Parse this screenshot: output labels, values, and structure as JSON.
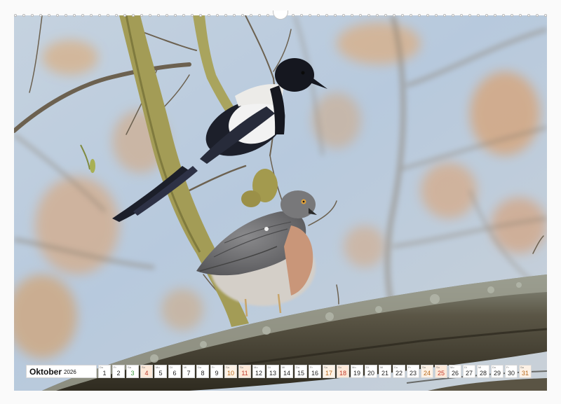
{
  "calendar": {
    "month": "Oktober",
    "year": "2026",
    "days": [
      {
        "num": "1",
        "wd": "Do",
        "type": "weekday"
      },
      {
        "num": "2",
        "wd": "Fr",
        "type": "weekday"
      },
      {
        "num": "3",
        "wd": "Sa",
        "type": "holiday"
      },
      {
        "num": "4",
        "wd": "So",
        "type": "sun"
      },
      {
        "num": "5",
        "wd": "Mo",
        "type": "weekday"
      },
      {
        "num": "6",
        "wd": "Di",
        "type": "weekday"
      },
      {
        "num": "7",
        "wd": "Mi",
        "type": "weekday"
      },
      {
        "num": "8",
        "wd": "Do",
        "type": "weekday"
      },
      {
        "num": "9",
        "wd": "Fr",
        "type": "weekday"
      },
      {
        "num": "10",
        "wd": "Sa",
        "type": "sat"
      },
      {
        "num": "11",
        "wd": "So",
        "type": "sun"
      },
      {
        "num": "12",
        "wd": "Mo",
        "type": "weekday"
      },
      {
        "num": "13",
        "wd": "Di",
        "type": "weekday"
      },
      {
        "num": "14",
        "wd": "Mi",
        "type": "weekday"
      },
      {
        "num": "15",
        "wd": "Do",
        "type": "weekday"
      },
      {
        "num": "16",
        "wd": "Fr",
        "type": "weekday"
      },
      {
        "num": "17",
        "wd": "Sa",
        "type": "sat"
      },
      {
        "num": "18",
        "wd": "So",
        "type": "sun"
      },
      {
        "num": "19",
        "wd": "Mo",
        "type": "weekday"
      },
      {
        "num": "20",
        "wd": "Di",
        "type": "weekday"
      },
      {
        "num": "21",
        "wd": "Mi",
        "type": "weekday"
      },
      {
        "num": "22",
        "wd": "Do",
        "type": "weekday"
      },
      {
        "num": "23",
        "wd": "Fr",
        "type": "weekday"
      },
      {
        "num": "24",
        "wd": "Sa",
        "type": "sat"
      },
      {
        "num": "25",
        "wd": "So",
        "type": "sun"
      },
      {
        "num": "26",
        "wd": "Mo",
        "type": "weekday"
      },
      {
        "num": "27",
        "wd": "Di",
        "type": "weekday"
      },
      {
        "num": "28",
        "wd": "Mi",
        "type": "weekday"
      },
      {
        "num": "29",
        "wd": "Do",
        "type": "weekday"
      },
      {
        "num": "30",
        "wd": "Fr",
        "type": "weekday"
      },
      {
        "num": "31",
        "wd": "Sa",
        "type": "sat"
      }
    ]
  },
  "photo": {
    "subject_icons": [
      "magpie-icon",
      "sparrowhawk-icon",
      "branch-icon"
    ],
    "colors": {
      "sky": "#b9cbe0",
      "bokeh_warm": "#d9a77a",
      "bark": "#4b4433",
      "lichen": "#9aa08f",
      "magpie_black": "#1c1f2a",
      "hawk_grey": "#6f6f70",
      "hawk_breast": "#cfa486",
      "twig": "#a6a04a"
    }
  }
}
